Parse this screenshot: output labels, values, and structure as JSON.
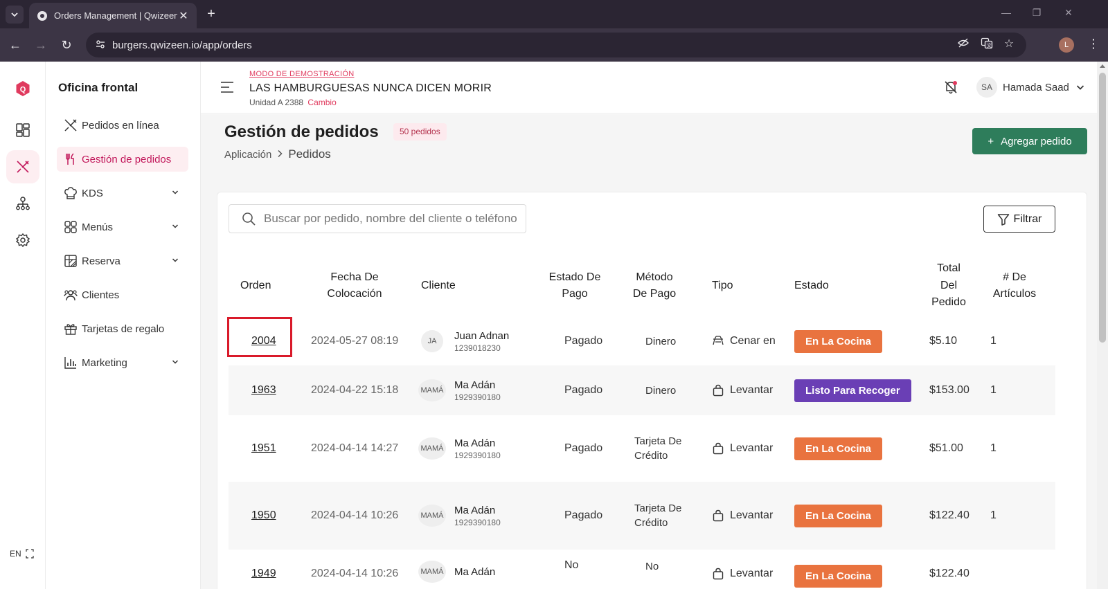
{
  "browser": {
    "tab_title": "Orders Management | Qwizeen",
    "url": "burgers.qwizeen.io/app/orders",
    "profile_initial": "L"
  },
  "rail": {
    "language": "EN"
  },
  "sidebar": {
    "title": "Oficina frontal",
    "items": [
      {
        "label": "Pedidos en línea",
        "icon": "utensils-crossed-icon"
      },
      {
        "label": "Gestión de pedidos",
        "icon": "fork-knife-icon",
        "active": true
      },
      {
        "label": "KDS",
        "icon": "chef-hat-icon",
        "expandable": true
      },
      {
        "label": "Menús",
        "icon": "grid-icon",
        "expandable": true
      },
      {
        "label": "Reserva",
        "icon": "table-icon",
        "expandable": true
      },
      {
        "label": "Clientes",
        "icon": "users-icon"
      },
      {
        "label": "Tarjetas de regalo",
        "icon": "gift-icon"
      },
      {
        "label": "Marketing",
        "icon": "bar-chart-icon",
        "expandable": true
      }
    ]
  },
  "header": {
    "demo_mode": "MODO DE DEMOSTRACIÓN",
    "store_name": "LAS HAMBURGUESAS NUNCA DICEN MORIR",
    "store_unit": "Unidad A 2388",
    "change_label": "Cambio",
    "user_initials": "SA",
    "user_name": "Hamada Saad"
  },
  "page": {
    "title": "Gestión de pedidos",
    "count_badge": "50 pedidos",
    "breadcrumb": [
      "Aplicación",
      "Pedidos"
    ],
    "add_button": "Agregar pedido"
  },
  "search": {
    "placeholder": "Buscar por pedido, nombre del cliente o teléfono"
  },
  "filter_label": "Filtrar",
  "table": {
    "headers": {
      "order": "Orden",
      "date": "Fecha De Colocación",
      "customer": "Cliente",
      "payment_status": "Estado De Pago",
      "payment_method": "Método De Pago",
      "type": "Tipo",
      "status": "Estado",
      "total": "Total Del Pedido",
      "items": "# De Artículos"
    },
    "rows": [
      {
        "order": "2004",
        "date": "2024-05-27 08:19",
        "avatar": "JA",
        "name": "Juan Adnan",
        "phone": "1239018230",
        "payment_status": "Pagado",
        "payment_method": "Dinero",
        "type": "Cenar en",
        "type_icon": "dine-in-icon",
        "status": "En La Cocina",
        "status_color": "#e9733f",
        "total": "$5.10",
        "items": "1"
      },
      {
        "order": "1963",
        "date": "2024-04-22 15:18",
        "avatar": "MAMÁ",
        "name": "Ma Adán",
        "phone": "1929390180",
        "payment_status": "Pagado",
        "payment_method": "Dinero",
        "type": "Levantar",
        "type_icon": "shopping-bag-icon",
        "status": "Listo Para Recoger",
        "status_color": "#6a3fb5",
        "total": "$153.00",
        "items": "1"
      },
      {
        "order": "1951",
        "date": "2024-04-14 14:27",
        "avatar": "MAMÁ",
        "name": "Ma Adán",
        "phone": "1929390180",
        "payment_status": "Pagado",
        "payment_method": "Tarjeta De Crédito",
        "type": "Levantar",
        "type_icon": "shopping-bag-icon",
        "status": "En La Cocina",
        "status_color": "#e9733f",
        "total": "$51.00",
        "items": "1"
      },
      {
        "order": "1950",
        "date": "2024-04-14 10:26",
        "avatar": "MAMÁ",
        "name": "Ma Adán",
        "phone": "1929390180",
        "payment_status": "Pagado",
        "payment_method": "Tarjeta De Crédito",
        "type": "Levantar",
        "type_icon": "shopping-bag-icon",
        "status": "En La Cocina",
        "status_color": "#e9733f",
        "total": "$122.40",
        "items": "1"
      },
      {
        "order": "1949",
        "date": "2024-04-14 10:26",
        "avatar": "MAMÁ",
        "name": "Ma Adán",
        "phone": "",
        "payment_status": "No",
        "payment_method": "No",
        "type": "Levantar",
        "type_icon": "shopping-bag-icon",
        "status": "En La Cocina",
        "status_color": "#e9733f",
        "total": "$122.40",
        "items": ""
      }
    ]
  }
}
